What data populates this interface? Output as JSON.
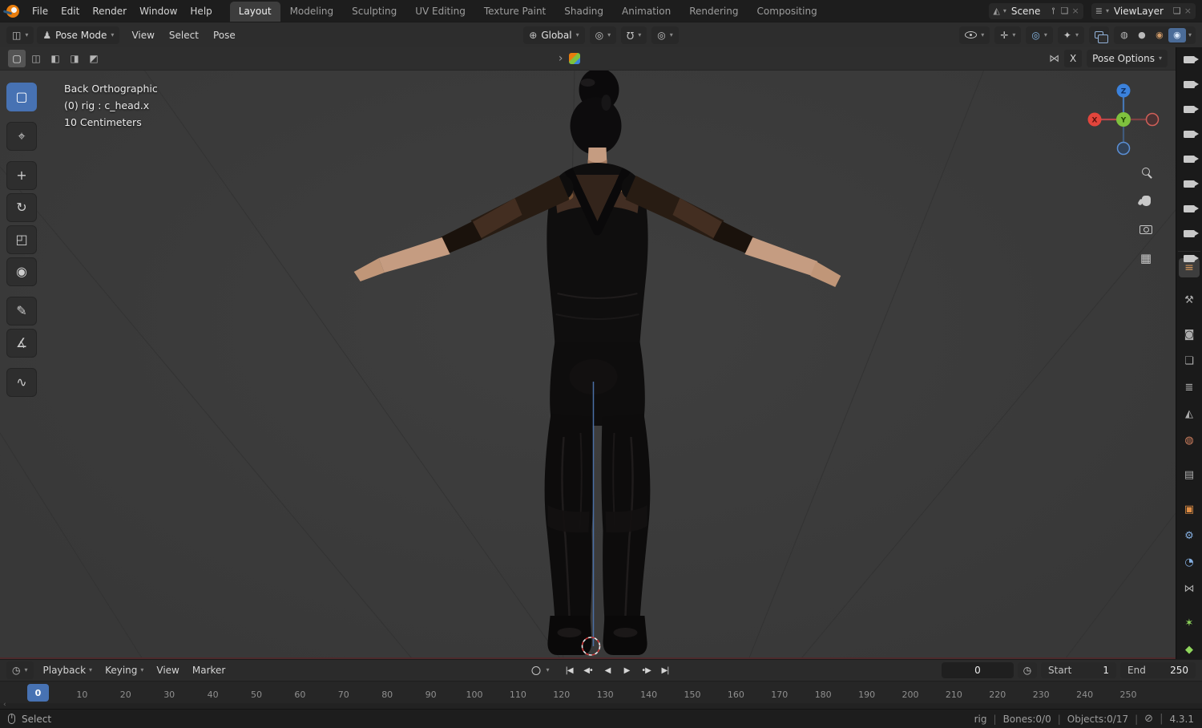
{
  "topbar": {
    "menus": [
      "File",
      "Edit",
      "Render",
      "Window",
      "Help"
    ],
    "workspace_tabs": [
      "Layout",
      "Modeling",
      "Sculpting",
      "UV Editing",
      "Texture Paint",
      "Shading",
      "Animation",
      "Rendering",
      "Compositing"
    ],
    "active_workspace": "Layout",
    "scene_selector": {
      "value": "Scene"
    },
    "view_layer_selector": {
      "value": "ViewLayer"
    }
  },
  "viewport_header": {
    "mode_selector": "Pose Mode",
    "menus": [
      "View",
      "Select",
      "Pose"
    ],
    "orientation_selector": "Global"
  },
  "tool_settings": {
    "select_modes": [
      {
        "name": "set",
        "glyph": "▢"
      },
      {
        "name": "extend",
        "glyph": "◫"
      },
      {
        "name": "subtract",
        "glyph": "◧"
      },
      {
        "name": "invert",
        "glyph": "◨"
      },
      {
        "name": "intersect",
        "glyph": "◩"
      }
    ],
    "mirror_x_label": "X",
    "pose_options_label": "Pose Options"
  },
  "toolbar_tools": [
    {
      "name": "select-box",
      "glyph": "▢",
      "active": true
    },
    {
      "name": "cursor",
      "glyph": "⌖",
      "gap": true
    },
    {
      "name": "move",
      "glyph": "+",
      "gap": true
    },
    {
      "name": "rotate",
      "glyph": "↻"
    },
    {
      "name": "scale",
      "glyph": "◰"
    },
    {
      "name": "transform",
      "glyph": "◉"
    },
    {
      "name": "annotate",
      "glyph": "✎",
      "gap": true
    },
    {
      "name": "measure",
      "glyph": "∡"
    },
    {
      "name": "pose-breakdowner",
      "glyph": "∿",
      "gap": true
    }
  ],
  "viewport_overlay": {
    "line1": "Back Orthographic",
    "line2": "(0) rig : c_head.x",
    "line3": "10 Centimeters"
  },
  "gizmo_axes": {
    "x": "X",
    "y": "Y",
    "z": "Z"
  },
  "outliner": {
    "camera_count": 9
  },
  "properties_tabs": [
    {
      "name": "tool",
      "glyph": "⚒",
      "color": "#ababab"
    },
    {
      "name": "render",
      "glyph": "◙",
      "color": "#ababab",
      "gap": true
    },
    {
      "name": "output",
      "glyph": "❏",
      "color": "#ababab"
    },
    {
      "name": "view-layer",
      "glyph": "≣",
      "color": "#ababab"
    },
    {
      "name": "scene",
      "glyph": "◭",
      "color": "#ababab"
    },
    {
      "name": "world",
      "glyph": "◍",
      "color": "#cf7f5f"
    },
    {
      "name": "collection",
      "glyph": "▤",
      "color": "#ababab",
      "gap": true
    },
    {
      "name": "object",
      "glyph": "▣",
      "color": "#e08e44",
      "gap": true
    },
    {
      "name": "modifiers",
      "glyph": "⚙",
      "color": "#84aee0"
    },
    {
      "name": "physics",
      "glyph": "◔",
      "color": "#84aee0"
    },
    {
      "name": "constraints",
      "glyph": "⋈",
      "color": "#ababab"
    },
    {
      "name": "object-data",
      "glyph": "✶",
      "color": "#8fd65c",
      "gap": true
    },
    {
      "name": "bone",
      "glyph": "◆",
      "color": "#8fd65c"
    }
  ],
  "timeline": {
    "menus": [
      {
        "label": "Playback",
        "dd": true
      },
      {
        "label": "Keying",
        "dd": true
      },
      {
        "label": "View",
        "dd": false
      },
      {
        "label": "Marker",
        "dd": false
      }
    ],
    "playback_buttons": [
      {
        "name": "jump-to-start",
        "glyph": "|◀"
      },
      {
        "name": "previous-keyframe",
        "glyph": "◀•"
      },
      {
        "name": "play-reverse",
        "glyph": "◀"
      },
      {
        "name": "play",
        "glyph": "▶"
      },
      {
        "name": "next-keyframe",
        "glyph": "•▶"
      },
      {
        "name": "jump-to-end",
        "glyph": "▶|"
      }
    ],
    "current_frame": "0",
    "playhead_label": "0",
    "start_label": "Start",
    "start_value": "1",
    "end_label": "End",
    "end_value": "250",
    "ticks": [
      "0",
      "10",
      "20",
      "30",
      "40",
      "50",
      "60",
      "70",
      "80",
      "90",
      "100",
      "110",
      "120",
      "130",
      "140",
      "150",
      "160",
      "170",
      "180",
      "190",
      "200",
      "210",
      "220",
      "230",
      "240",
      "250"
    ]
  },
  "statusbar": {
    "left_label": "Select",
    "object": "rig",
    "bones": "Bones:0/0",
    "objects": "Objects:0/17",
    "version": "4.3.1"
  },
  "colors": {
    "accent_blue": "#4772b3",
    "axis_x": "#e2453c",
    "axis_y": "#7fc13e",
    "axis_z": "#3b82dd",
    "skin": "#c59c81",
    "viewport_bg": "#3b3b3b"
  }
}
